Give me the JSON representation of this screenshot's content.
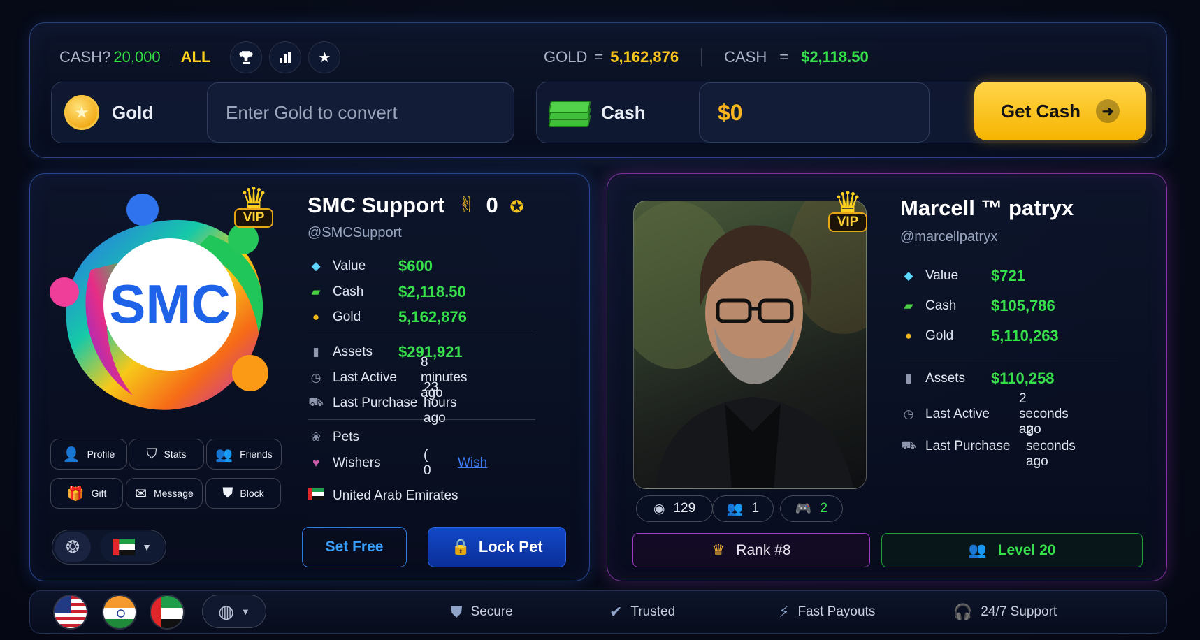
{
  "exchange": {
    "cash_label": "CASH?",
    "cash_value": "20,000",
    "all_label": "ALL",
    "icons": [
      "trophy-icon",
      "bar-chart-icon",
      "star-icon"
    ],
    "gold_rate_label": "GOLD",
    "gold_rate_eq": "=",
    "gold_rate_value": "5,162,876",
    "cash_rate_label": "CASH",
    "cash_rate_eq": "=",
    "cash_rate_value": "$2,118.50",
    "gold_label": "Gold",
    "gold_placeholder": "Enter Gold to convert",
    "cash_box_label": "Cash",
    "cash_output": "$0",
    "get_cash_label": "Get Cash",
    "get_cash_arrow": "➜"
  },
  "left_profile": {
    "logo_text": "SMC",
    "vip": "VIP",
    "name": "SMC Support",
    "name_emoji": "✌",
    "name_count": "0",
    "handle": "@SMCSupport",
    "stats": [
      {
        "icon": "diamond-icon",
        "label": "Value",
        "value": "$600"
      },
      {
        "icon": "cash-icon",
        "label": "Cash",
        "value": "$2,118.50"
      },
      {
        "icon": "coin-icon",
        "label": "Gold",
        "value": "5,162,876"
      },
      {
        "icon": "bar-chart-icon",
        "label": "Assets",
        "value": "$291,921"
      },
      {
        "icon": "clock-icon",
        "label": "Last Active",
        "value": "8 minutes ago"
      },
      {
        "icon": "cart-icon",
        "label": "Last Purchase",
        "value": "23 hours ago"
      }
    ],
    "pets_label": "Pets",
    "wishers_label": "Wishers",
    "wishers_prefix": "(",
    "wishers_value": "0",
    "wish_link": "Wish",
    "country": "United Arab Emirates",
    "actions": [
      "Profile",
      "Stats",
      "Friends",
      "Gift",
      "Message",
      "Block"
    ],
    "set_free": "Set Free",
    "lock_pet": "Lock Pet"
  },
  "right_profile": {
    "vip": "VIP",
    "name": "Marcell ™ patryx",
    "handle": "@marcellpatryx",
    "stats": [
      {
        "icon": "diamond-icon",
        "label": "Value",
        "value": "$721"
      },
      {
        "icon": "cash-icon",
        "label": "Cash",
        "value": "$105,786"
      },
      {
        "icon": "coin-icon",
        "label": "Gold",
        "value": "5,110,263"
      },
      {
        "icon": "bar-chart-icon",
        "label": "Assets",
        "value": "$110,258"
      },
      {
        "icon": "clock-icon",
        "label": "Last Active",
        "value": "2 seconds ago"
      },
      {
        "icon": "cart-icon",
        "label": "Last Purchase",
        "value": "2 seconds ago"
      }
    ],
    "views": "129",
    "friends": "1",
    "games": "2",
    "rank": "Rank #8",
    "level": "Level 20"
  },
  "footer": {
    "trust": [
      "Secure",
      "Trusted",
      "Fast Payouts",
      "24/7 Support"
    ]
  },
  "colors": {
    "accent_green": "#36e04a",
    "accent_yellow": "#ffd21f",
    "accent_blue": "#1348c8",
    "accent_purple": "#a23bbf"
  }
}
